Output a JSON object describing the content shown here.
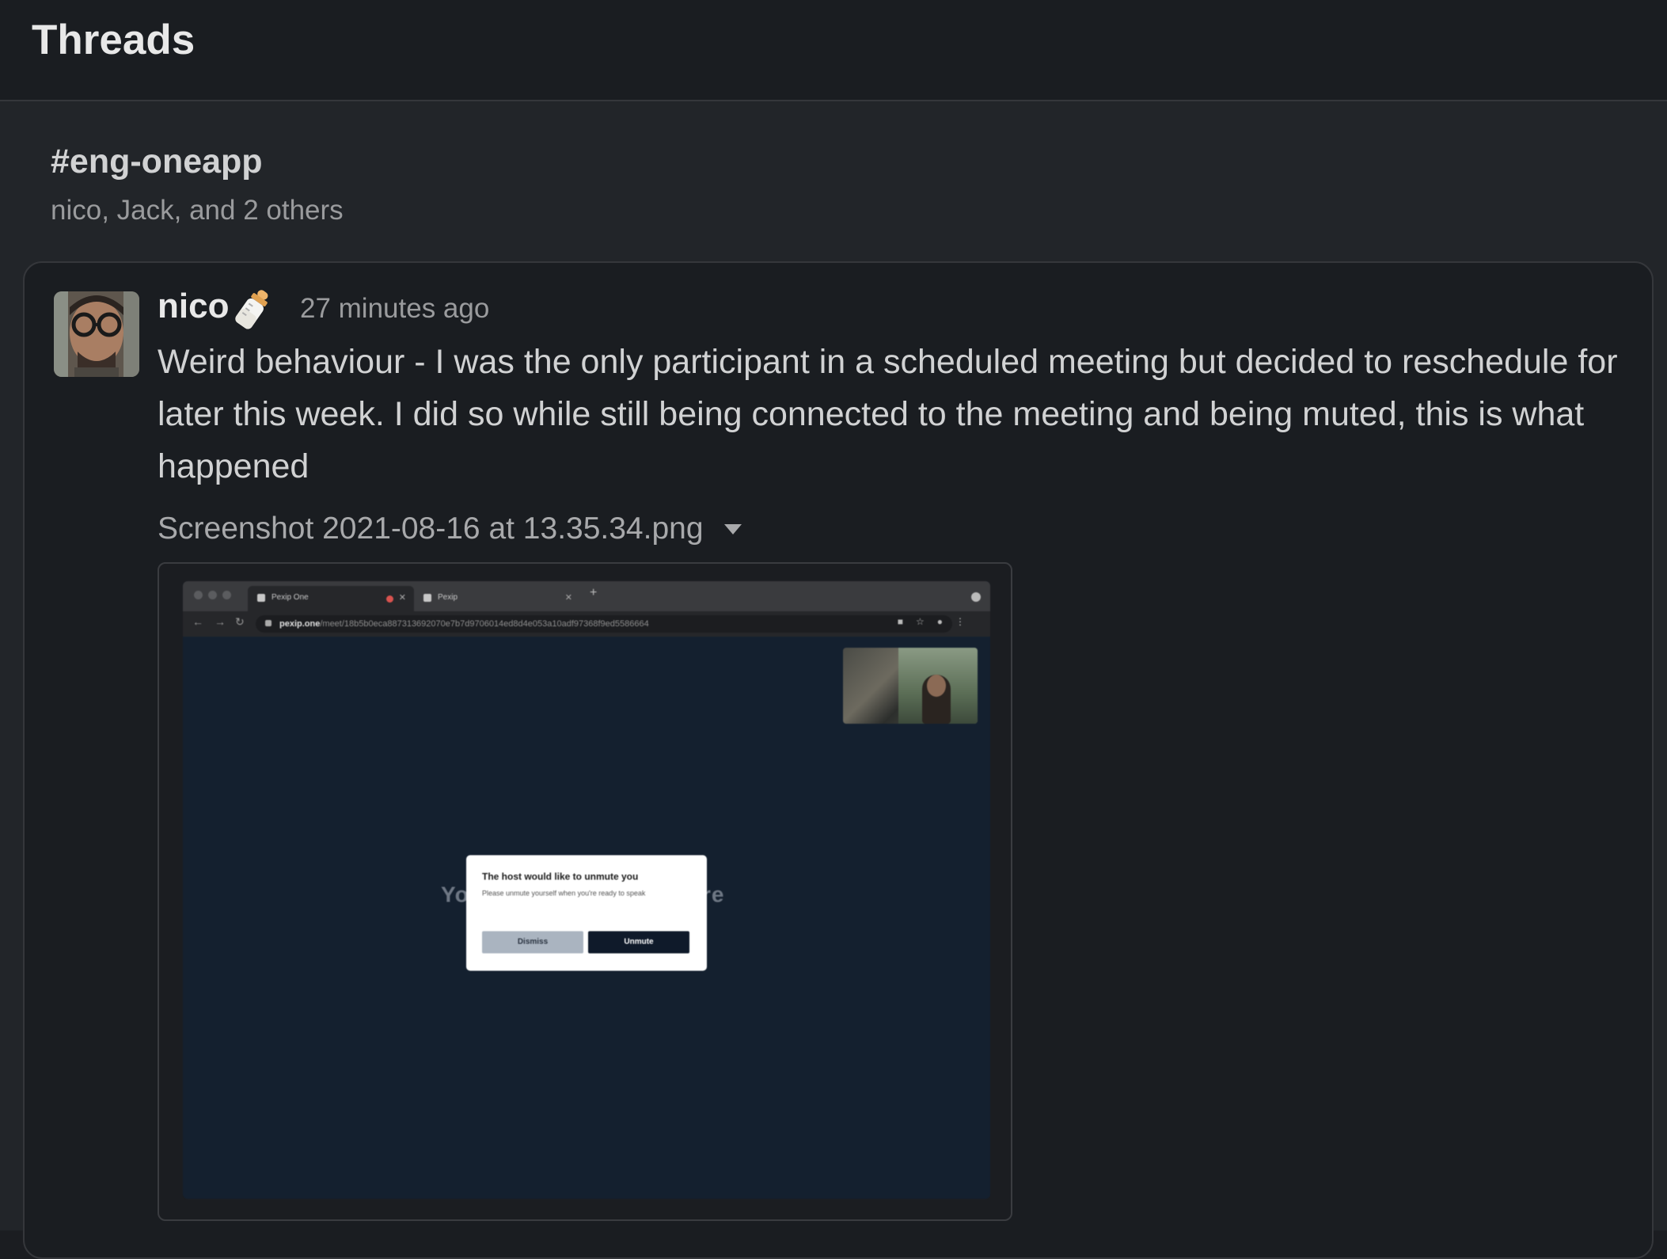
{
  "header": {
    "title": "Threads"
  },
  "thread": {
    "channel": "#eng-oneapp",
    "participants": "nico, Jack, and 2 others"
  },
  "message": {
    "author": "nico",
    "status_icon": "baby-bottle-icon",
    "timestamp": "27 minutes ago",
    "text": "Weird behaviour - I was the only participant in a scheduled meeting but decided to reschedule for later this week. I did so while still being connected to the meeting and being muted, this is what happened",
    "attachment": {
      "filename": "Screenshot 2021-08-16 at 13.35.34.png",
      "expand_icon": "caret-down-icon"
    }
  },
  "preview": {
    "tabs": [
      "Pexip One",
      "Pexip"
    ],
    "url_host": "pexip.one",
    "url_path": "/meet/18b5b0eca887313692070e7b7d9706014ed8d4e053a10adf97368f9ed5586664",
    "background_text_left": "Yo",
    "background_text_right": "re",
    "dialog": {
      "title": "The host would like to unmute you",
      "body": "Please unmute yourself when you're ready to speak",
      "dismiss_label": "Dismiss",
      "unmute_label": "Unmute"
    }
  },
  "colors": {
    "background": "#1a1d21",
    "thread_area": "#222529",
    "text": "#d1d2d3",
    "muted_text": "#9a9b9d",
    "meeting_bg": "#14202f"
  }
}
